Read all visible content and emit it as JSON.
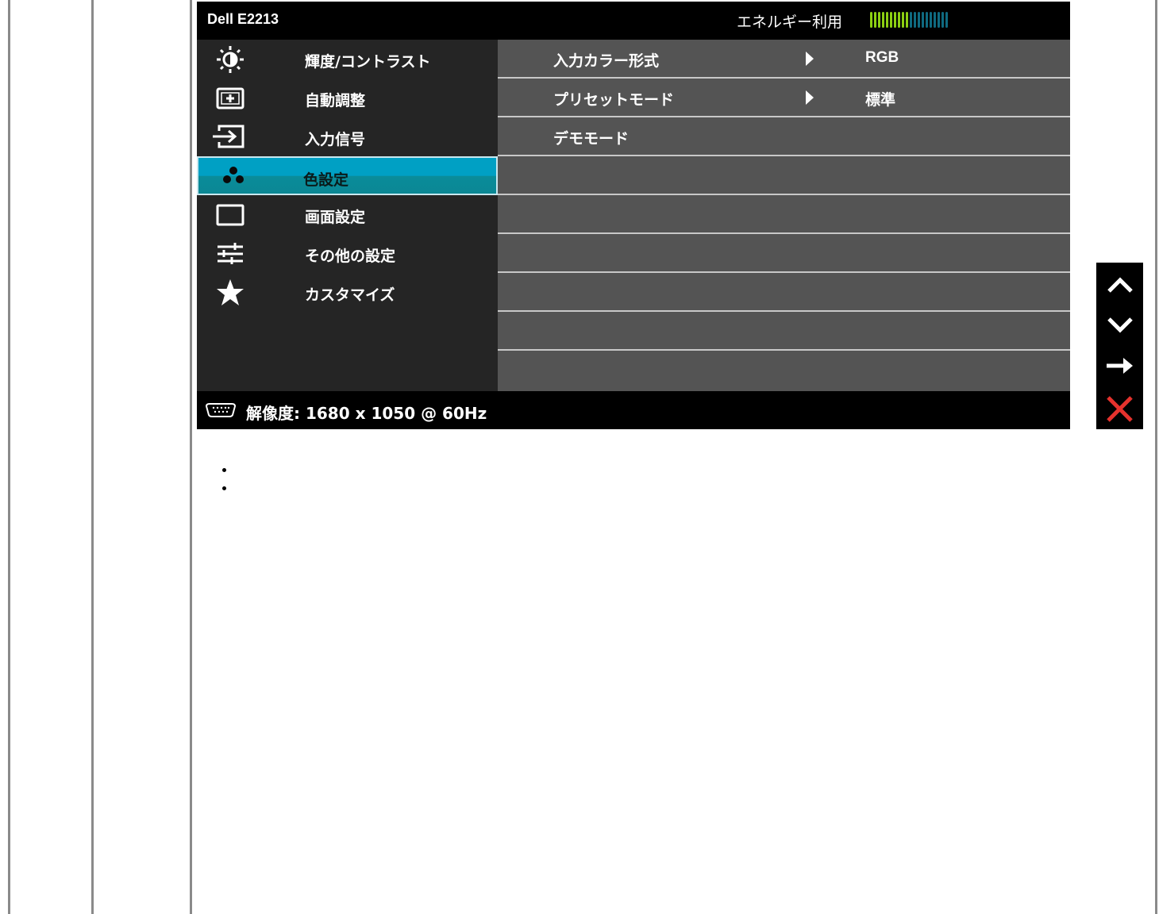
{
  "osd": {
    "model": "Dell E2213",
    "energy_label": "エネルギー利用",
    "energy_level": {
      "active_bars": 10,
      "total_bars": 20
    },
    "menu_items": [
      {
        "label": "輝度/コントラスト",
        "icon": "brightness-icon"
      },
      {
        "label": "自動調整",
        "icon": "auto-adjust-icon"
      },
      {
        "label": "入力信号",
        "icon": "input-source-icon"
      },
      {
        "label": "色設定",
        "icon": "color-settings-icon",
        "selected": true
      },
      {
        "label": "画面設定",
        "icon": "display-settings-icon"
      },
      {
        "label": "その他の設定",
        "icon": "other-settings-icon"
      },
      {
        "label": "カスタマイズ",
        "icon": "star-icon"
      }
    ],
    "submenu": [
      {
        "label": "入力カラー形式",
        "has_arrow": true,
        "value": "RGB"
      },
      {
        "label": "プリセットモード",
        "has_arrow": true,
        "value": "標準"
      },
      {
        "label": "デモモード",
        "has_arrow": false,
        "value": ""
      }
    ],
    "footer": {
      "resolution": "解像度: 1680 x 1050 @ 60Hz",
      "icon": "vga-connector-icon"
    }
  },
  "side_buttons": [
    "up-arrow-icon",
    "down-arrow-icon",
    "right-arrow-icon",
    "close-icon"
  ],
  "colors": {
    "selected_top": "#00a0c4",
    "selected_bottom": "#0b8794",
    "energy_active": "#8ccf12",
    "energy_inactive": "#0f6a80",
    "close_red": "#e5322d"
  }
}
